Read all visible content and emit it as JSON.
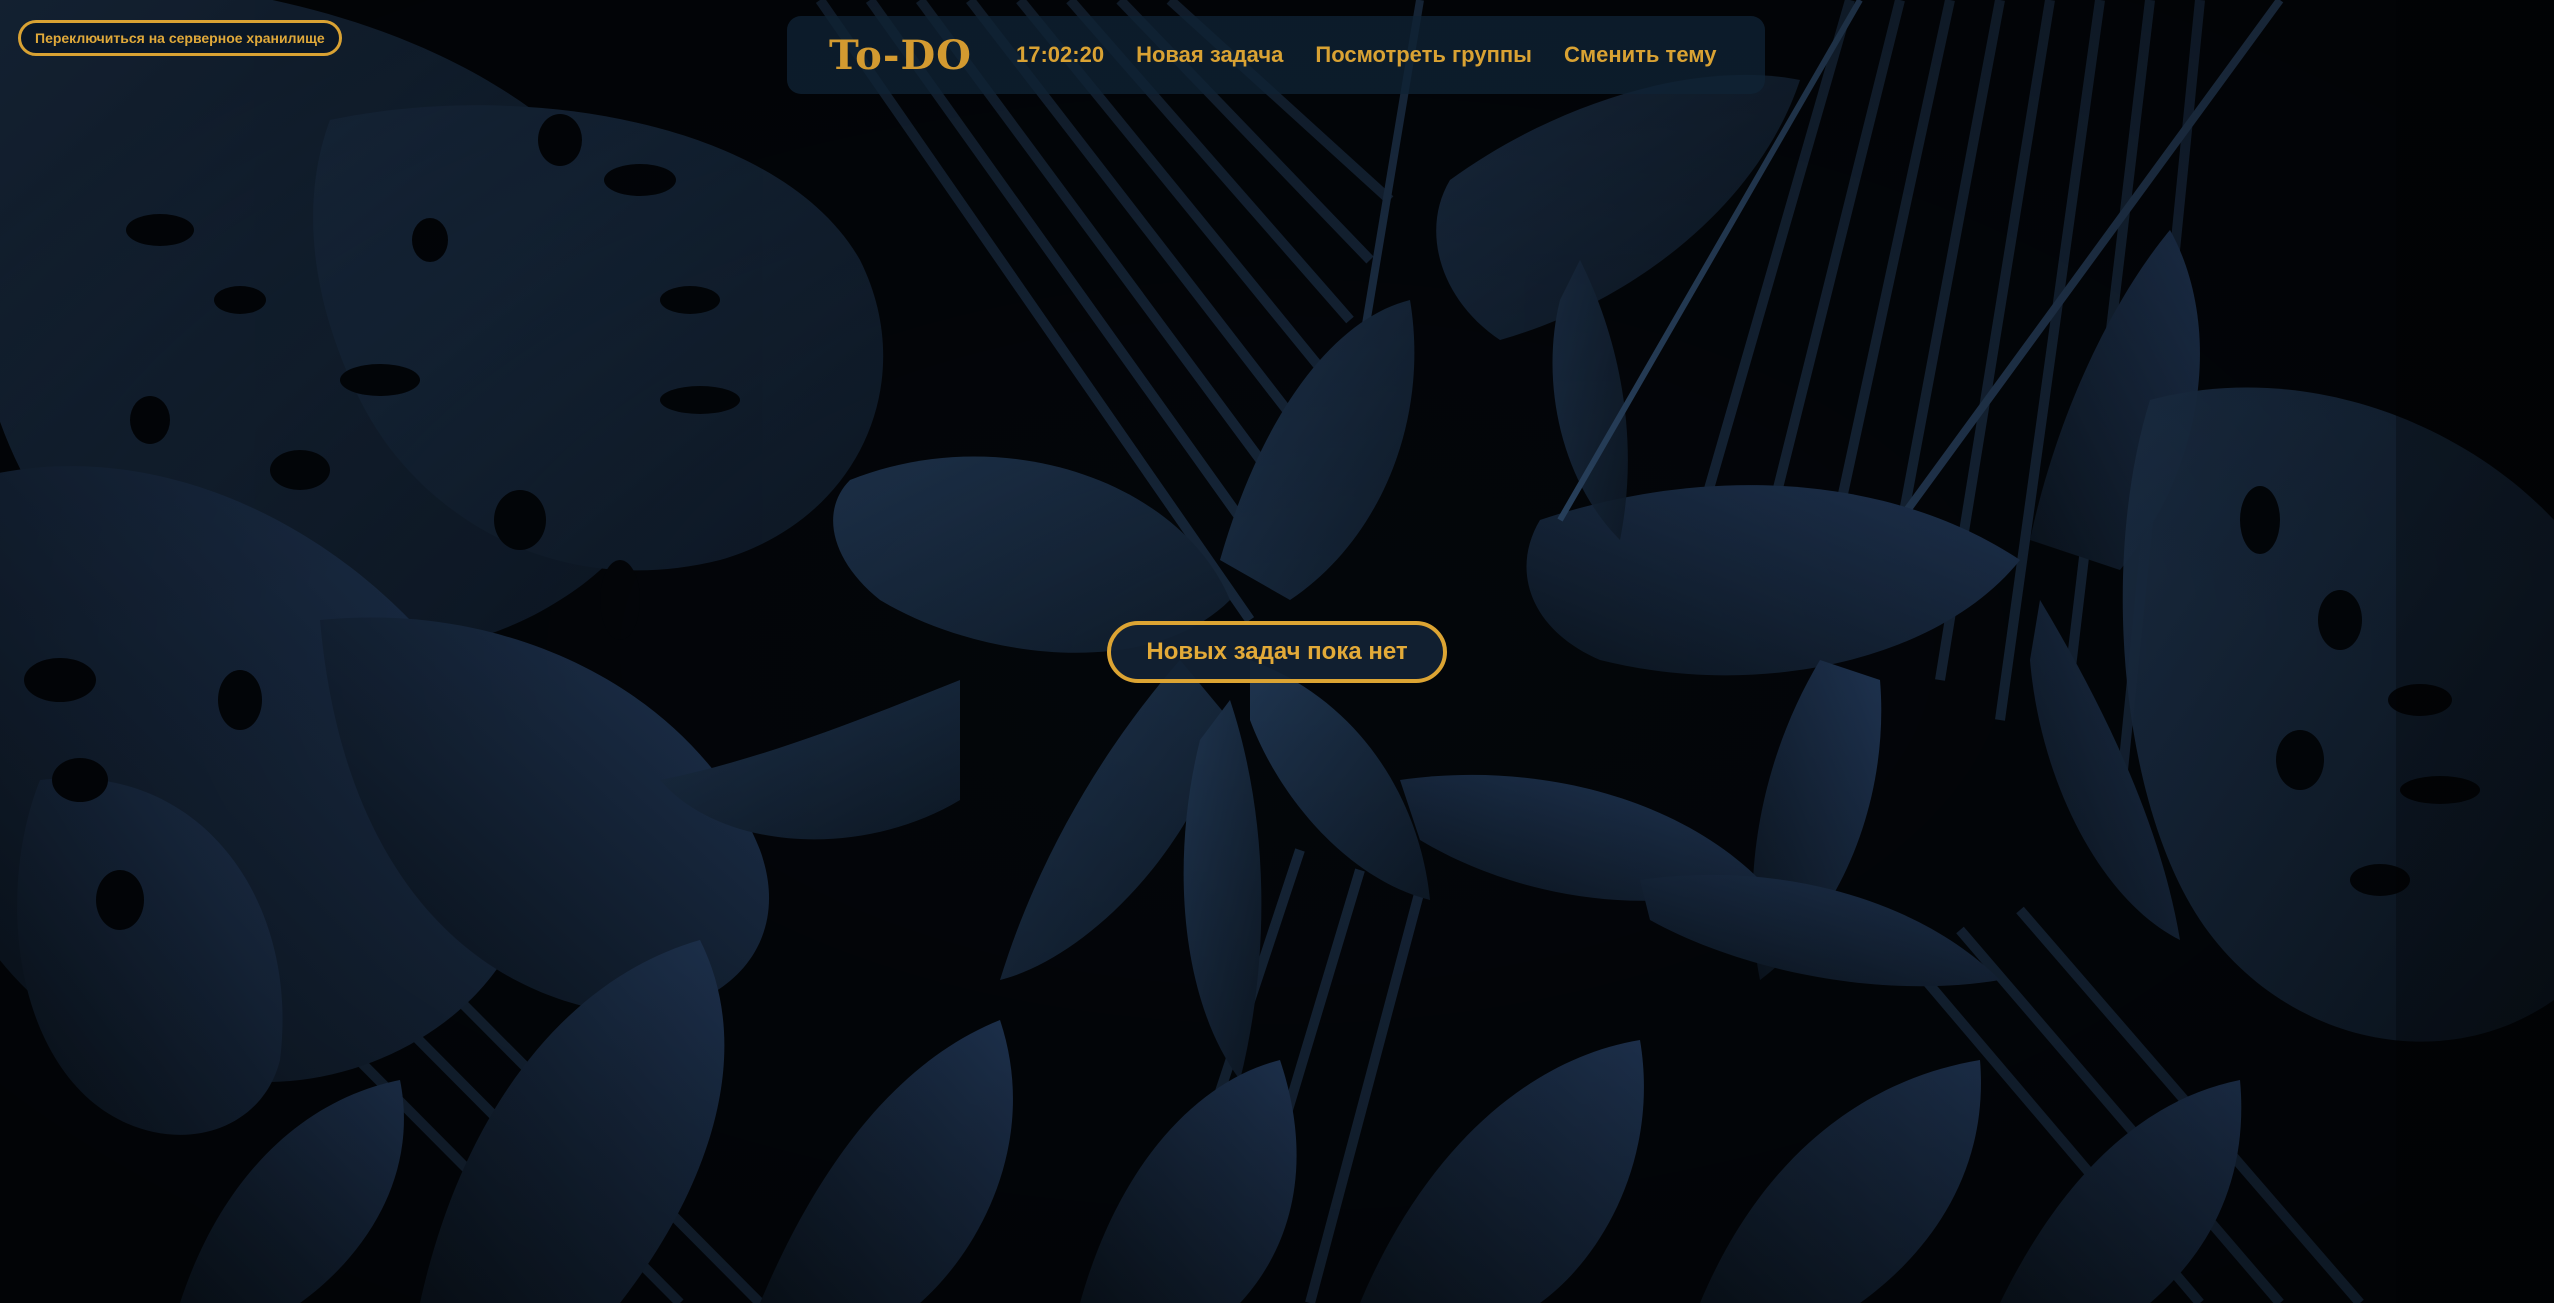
{
  "storage_toggle": {
    "label": "Переключиться на серверное хранилище"
  },
  "header": {
    "logo": "To-DO",
    "clock": "17:02:20",
    "nav": {
      "new_task": "Новая задача",
      "view_groups": "Посмотреть группы",
      "change_theme": "Сменить тему"
    }
  },
  "main": {
    "empty_message": "Новых задач пока нет"
  },
  "colors": {
    "accent": "#d9a233",
    "background": "#03060a",
    "leaf": "#1b2e44",
    "navbar": "#10222f"
  }
}
